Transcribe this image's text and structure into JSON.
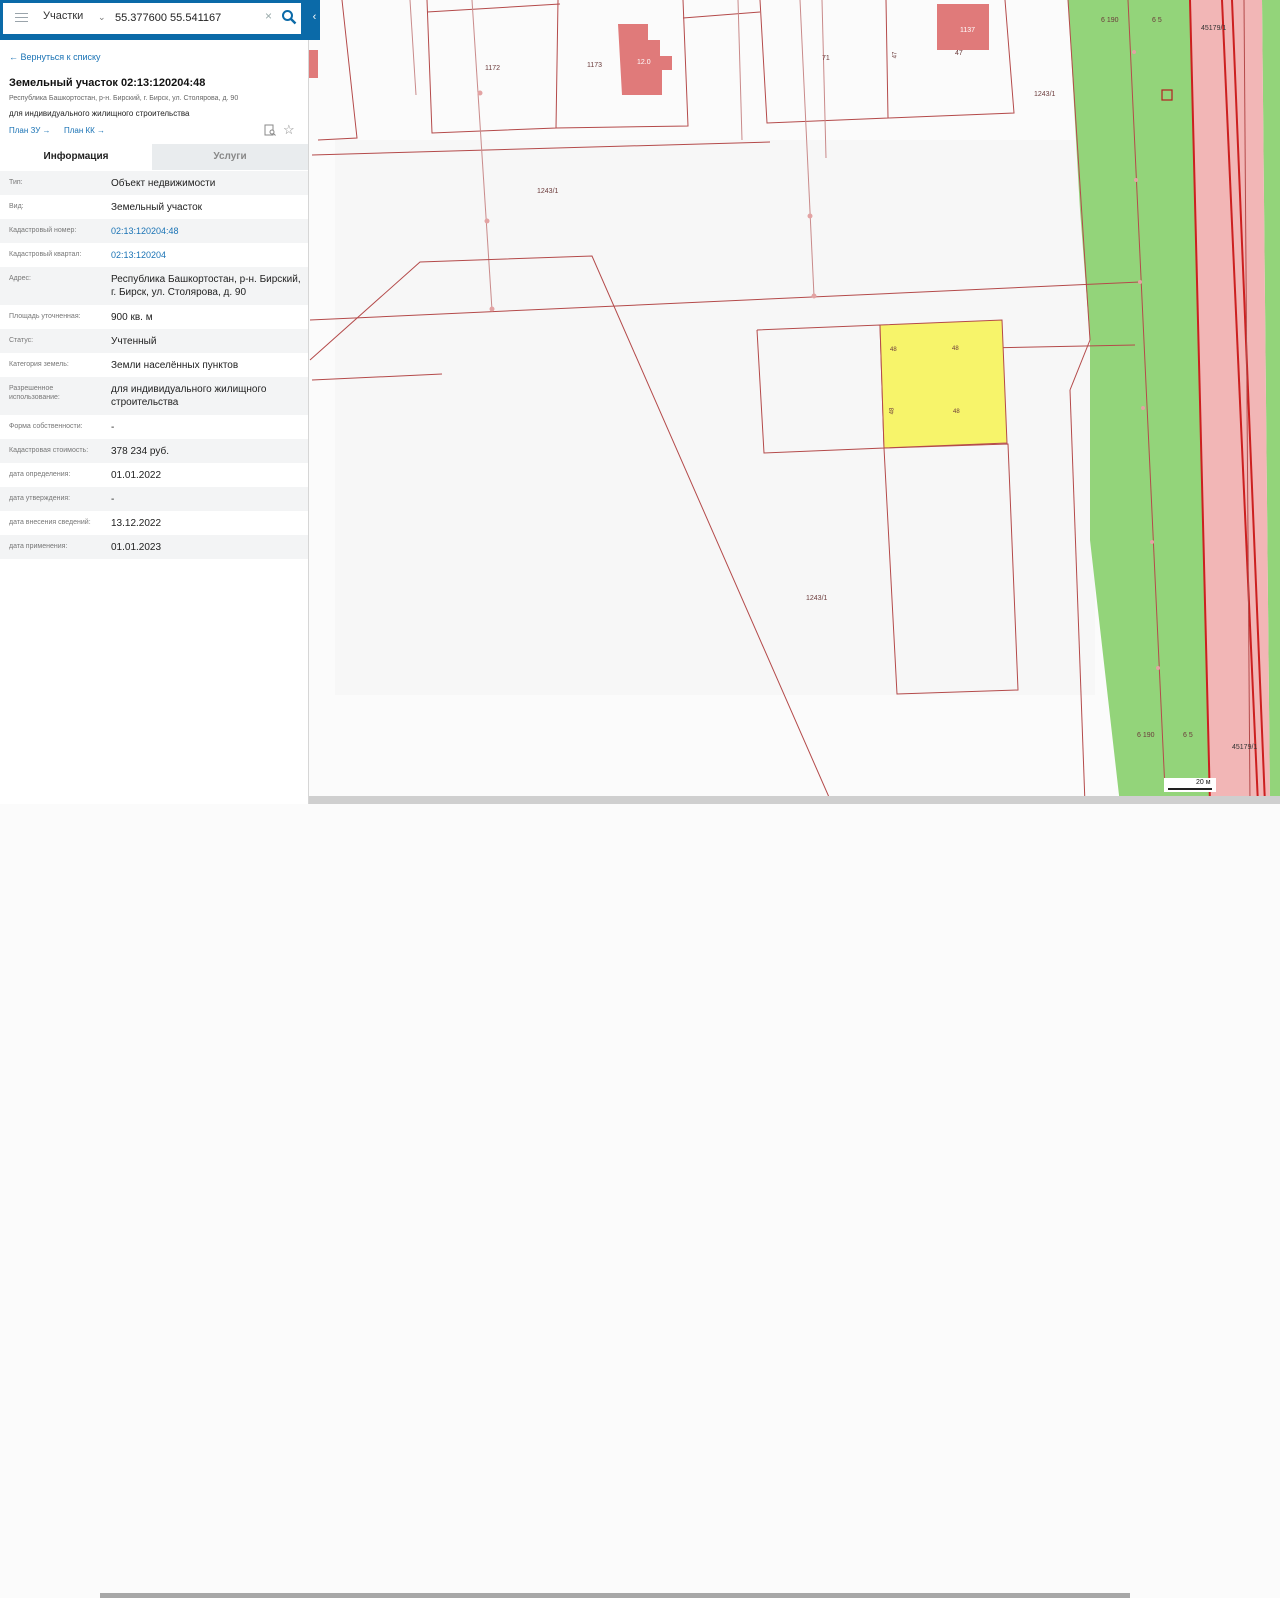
{
  "search": {
    "layer": "Участки",
    "query": "55.377600 55.541167"
  },
  "card": {
    "back_label": "← Вернуться к списку",
    "title": "Земельный участок 02:13:120204:48",
    "address": "Республика Башкортостан, р-н. Бирский, г. Бирск, ул. Столярова, д. 90",
    "purpose": "для индивидуального жилищного строительства",
    "plan_zu": "План ЗУ →",
    "plan_kk": "План КК →"
  },
  "tabs": {
    "info": "Информация",
    "services": "Услуги"
  },
  "properties": [
    {
      "key": "Тип:",
      "value": "Объект недвижимости"
    },
    {
      "key": "Вид:",
      "value": "Земельный участок"
    },
    {
      "key": "Кадастровый номер:",
      "value": "02:13:120204:48",
      "link": true
    },
    {
      "key": "Кадастровый квартал:",
      "value": "02:13:120204",
      "link": true
    },
    {
      "key": "Адрес:",
      "value": "Республика Башкортостан, р-н. Бирский, г. Бирск, ул. Столярова, д. 90"
    },
    {
      "key": "Площадь уточненная:",
      "value": "900 кв. м"
    },
    {
      "key": "Статус:",
      "value": "Учтенный"
    },
    {
      "key": "Категория земель:",
      "value": "Земли населённых пунктов"
    },
    {
      "key": "Разрешенное использование:",
      "value": "для индивидуального жилищного строительства"
    },
    {
      "key": "Форма собственности:",
      "value": "-"
    },
    {
      "key": "Кадастровая стоимость:",
      "value": "378 234 руб."
    },
    {
      "key": "дата определения:",
      "value": "01.01.2022"
    },
    {
      "key": "дата утверждения:",
      "value": "-"
    },
    {
      "key": "дата внесения сведений:",
      "value": "13.12.2022"
    },
    {
      "key": "дата применения:",
      "value": "01.01.2023"
    }
  ],
  "map": {
    "labels": {
      "p1172": "1172",
      "p1173": "1173",
      "b1240": "12.0",
      "p71": "71",
      "p47a": "47",
      "b1137": "1137",
      "p47b": "47",
      "q1243a": "1243/1",
      "q1243b": "1243/1",
      "q1243c": "1243/1",
      "p48a": "48",
      "p48b": "48",
      "p48c": "48",
      "p48d": "48",
      "r6190a": "6 190",
      "r65a": "6 5",
      "r45179a": "45179/1",
      "r6190b": "6 190",
      "r65b": "6 5",
      "r45179b": "45179/1"
    },
    "scale_label": "20 м",
    "colors": {
      "road_green": "#93d47a",
      "road_pink": "#f2b6b6",
      "building": "#e07a7a",
      "selected": "#f7f46a",
      "boundary": "#b44a4a"
    }
  }
}
